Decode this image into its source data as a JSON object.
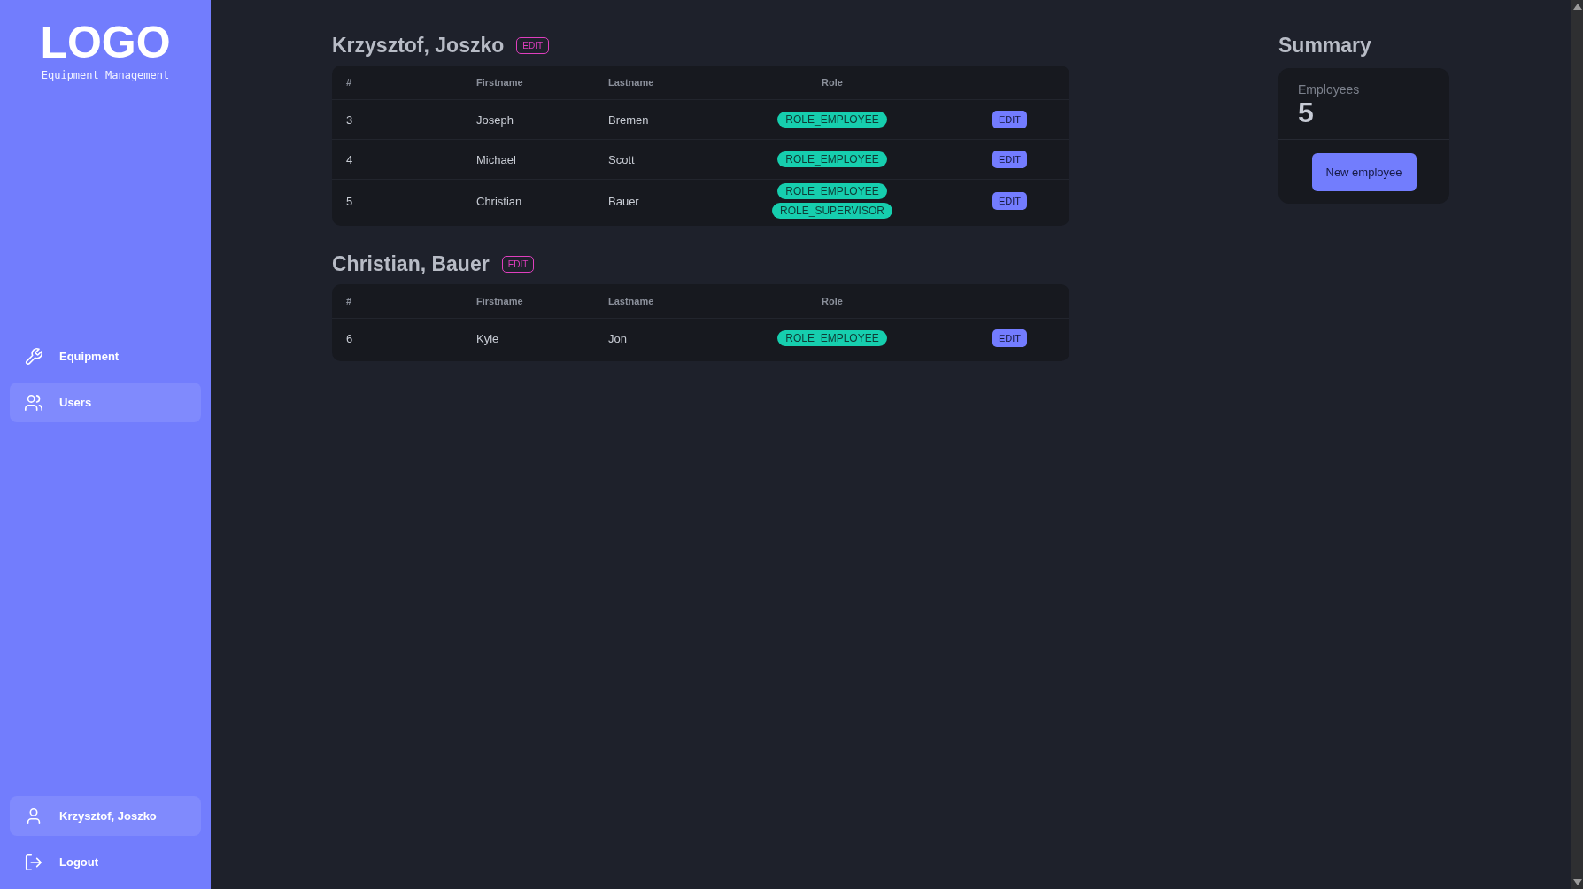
{
  "sidebar": {
    "logo": "LOGO",
    "subtitle": "Equipment Management",
    "nav": [
      {
        "kind": "wrench",
        "label": "Equipment",
        "selected": false
      },
      {
        "kind": "users",
        "label": "Users",
        "selected": true
      }
    ],
    "account": [
      {
        "kind": "user",
        "label": "Krzysztof, Joszko",
        "selected": true
      },
      {
        "kind": "logout",
        "label": "Logout",
        "selected": false
      }
    ]
  },
  "groups": [
    {
      "title": "Krzysztof, Joszko",
      "edit": "EDIT",
      "columns": [
        "#",
        "Firstname",
        "Lastname",
        "Role"
      ],
      "rows": [
        {
          "id": "3",
          "firstname": "Joseph",
          "lastname": "Bremen",
          "roles": [
            "ROLE_EMPLOYEE"
          ],
          "action": "EDIT"
        },
        {
          "id": "4",
          "firstname": "Michael",
          "lastname": "Scott",
          "roles": [
            "ROLE_EMPLOYEE"
          ],
          "action": "EDIT"
        },
        {
          "id": "5",
          "firstname": "Christian",
          "lastname": "Bauer",
          "roles": [
            "ROLE_EMPLOYEE",
            "ROLE_SUPERVISOR"
          ],
          "action": "EDIT"
        }
      ]
    },
    {
      "title": "Christian, Bauer",
      "edit": "EDIT",
      "columns": [
        "#",
        "Firstname",
        "Lastname",
        "Role"
      ],
      "rows": [
        {
          "id": "6",
          "firstname": "Kyle",
          "lastname": "Jon",
          "roles": [
            "ROLE_EMPLOYEE"
          ],
          "action": "EDIT"
        }
      ]
    }
  ],
  "summary": {
    "title": "Summary",
    "stat_label": "Employees",
    "stat_value": "5",
    "button": "New employee"
  }
}
